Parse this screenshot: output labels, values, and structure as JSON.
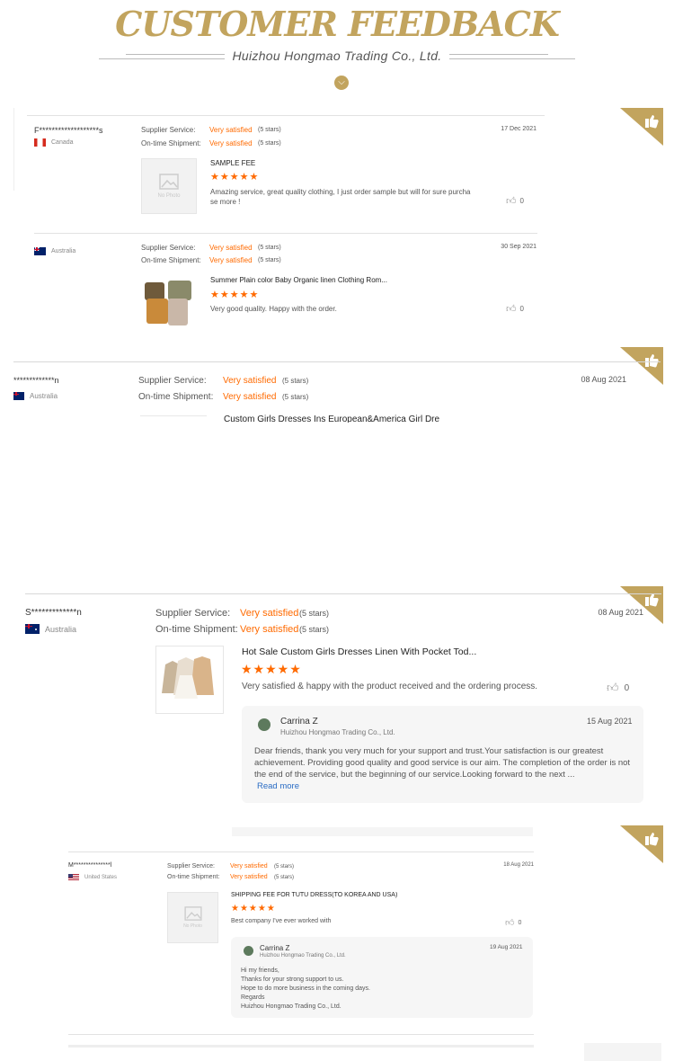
{
  "header": {
    "title": "CUSTOMER FEEDBACK",
    "subtitle": "Huizhou Hongmao Trading Co., Ltd."
  },
  "labels": {
    "supplier_service": "Supplier Service:",
    "ontime_shipment": "On-time Shipment:",
    "no_photo": "No Photo",
    "read_more": "Read more"
  },
  "colors": {
    "gold": "#c2a45e",
    "orange": "#ff6a00",
    "link": "#2a6cc4"
  },
  "reviews": [
    {
      "name": "F*******************s",
      "country": "Canada",
      "flag": "canada",
      "supplier_service": "Very satisfied",
      "supplier_stars": "(5 stars)",
      "shipment": "Very satisfied",
      "shipment_stars": "(5 stars)",
      "date": "17 Dec 2021",
      "product": "SAMPLE FEE",
      "rating": 5,
      "comment": "Amazing service, great quality clothing, I just order sample but will for sure purcha se more !",
      "likes": "0"
    },
    {
      "name": "",
      "country": "Australia",
      "flag": "australia",
      "supplier_service": "Very satisfied",
      "supplier_stars": "(5 stars)",
      "shipment": "Very satisfied",
      "shipment_stars": "(5 stars)",
      "date": "30 Sep 2021",
      "product": "Summer Plain color Baby Organic linen Clothing Rom...",
      "rating": 5,
      "comment": "Very good quality. Happy with the order.",
      "likes": "0"
    },
    {
      "name": "*************n",
      "country": "Australia",
      "flag": "australia",
      "supplier_service": "Very satisfied",
      "supplier_stars": "(5 stars)",
      "shipment": "Very satisfied",
      "shipment_stars": "(5 stars)",
      "date": "08 Aug 2021",
      "product": "Custom Girls Dresses Ins European&America Girl Dre"
    },
    {
      "name": "S*************n",
      "country": "Australia",
      "flag": "australia",
      "supplier_service": "Very satisfied",
      "supplier_stars": "(5 stars)",
      "shipment": "Very satisfied",
      "shipment_stars": "(5 stars)",
      "date": "08 Aug 2021",
      "product": "Hot Sale Custom Girls Dresses Linen With Pocket Tod...",
      "rating": 5,
      "comment": "Very satisfied & happy with the product received and the ordering process.",
      "likes": "0",
      "reply": {
        "name": "Carrina Z",
        "company": "Huizhou Hongmao Trading Co., Ltd.",
        "date": "15 Aug 2021",
        "text": "Dear friends, thank you very much for your support and trust.Your satisfaction is our greatest achievement. Providing good quality and good service is our aim. The completion of the order is not the end of the service, but the beginning of our service.Looking forward to the next ..."
      }
    },
    {
      "name": "M***************l",
      "country": "United States",
      "flag": "usa",
      "supplier_service": "Very satisfied",
      "supplier_stars": "(5 stars)",
      "shipment": "Very satisfied",
      "shipment_stars": "(5 stars)",
      "date": "18 Aug 2021",
      "product": "SHIPPING FEE FOR TUTU DRESS(TO KOREA AND USA)",
      "rating": 5,
      "comment": "Best company I've ever worked with",
      "likes": "0",
      "reply": {
        "name": "Carrina Z",
        "company": "Huizhou Hongmao Trading Co., Ltd.",
        "date": "19 Aug 2021",
        "lines": [
          "Hi my friends,",
          "Thanks for your strong support to us.",
          "Hope to do more business in the coming days.",
          "Regards",
          "Huizhou Hongmao Trading Co., Ltd."
        ]
      }
    }
  ]
}
